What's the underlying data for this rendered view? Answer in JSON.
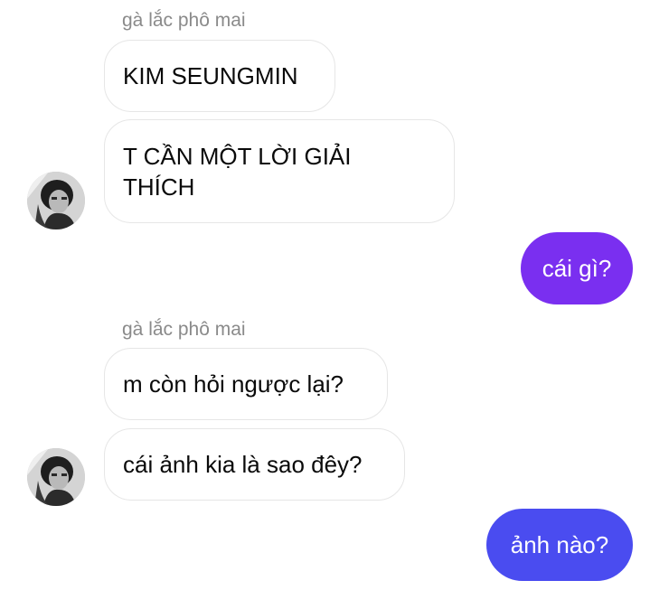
{
  "conversation": {
    "groups": [
      {
        "sender": "gà lắc phô mai",
        "messages": [
          "KIM SEUNGMIN",
          "T CẦN MỘT LỜI GIẢI THÍCH"
        ]
      },
      {
        "sender": "gà lắc phô mai",
        "messages": [
          "m còn hỏi ngược lại?",
          "cái ảnh kia là sao đêy?"
        ]
      }
    ],
    "outgoing": [
      "cái gì?",
      "ảnh nào?"
    ]
  },
  "colors": {
    "outgoing_1": "#7a2ff0",
    "outgoing_2": "#4a4cf0",
    "incoming_border": "#e6e6e6",
    "sender_text": "#8a8a8a"
  }
}
